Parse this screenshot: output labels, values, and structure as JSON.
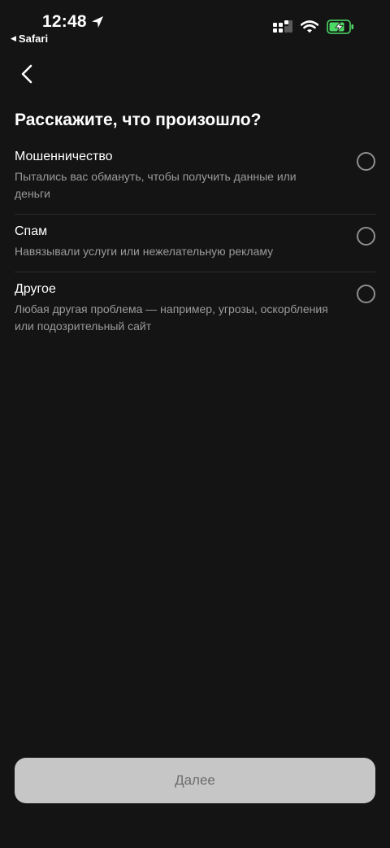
{
  "status_bar": {
    "time": "12:48",
    "back_app_label": "Safari",
    "location_icon": "location-arrow-icon",
    "signal_icon": "cellular-signal-icon",
    "wifi_icon": "wifi-icon",
    "battery_icon": "battery-charging-icon",
    "battery_color": "#4cd964"
  },
  "header": {
    "back_icon": "chevron-left-icon",
    "title": "Расскажите, что произошло?"
  },
  "options": [
    {
      "title": "Мошенничество",
      "description": "Пытались вас обмануть, чтобы получить данные или деньги",
      "selected": false
    },
    {
      "title": "Спам",
      "description": "Навязывали услуги или нежелательную рекламу",
      "selected": false
    },
    {
      "title": "Другое",
      "description": "Любая другая проблема — например, угрозы, оскорбления или подозрительный сайт",
      "selected": false
    }
  ],
  "footer": {
    "next_label": "Далее",
    "next_enabled": false
  },
  "colors": {
    "background": "#141414",
    "secondary_text": "#9a9a9a",
    "button_disabled_bg": "#c6c6c6",
    "button_disabled_text": "#6d6d6d"
  }
}
